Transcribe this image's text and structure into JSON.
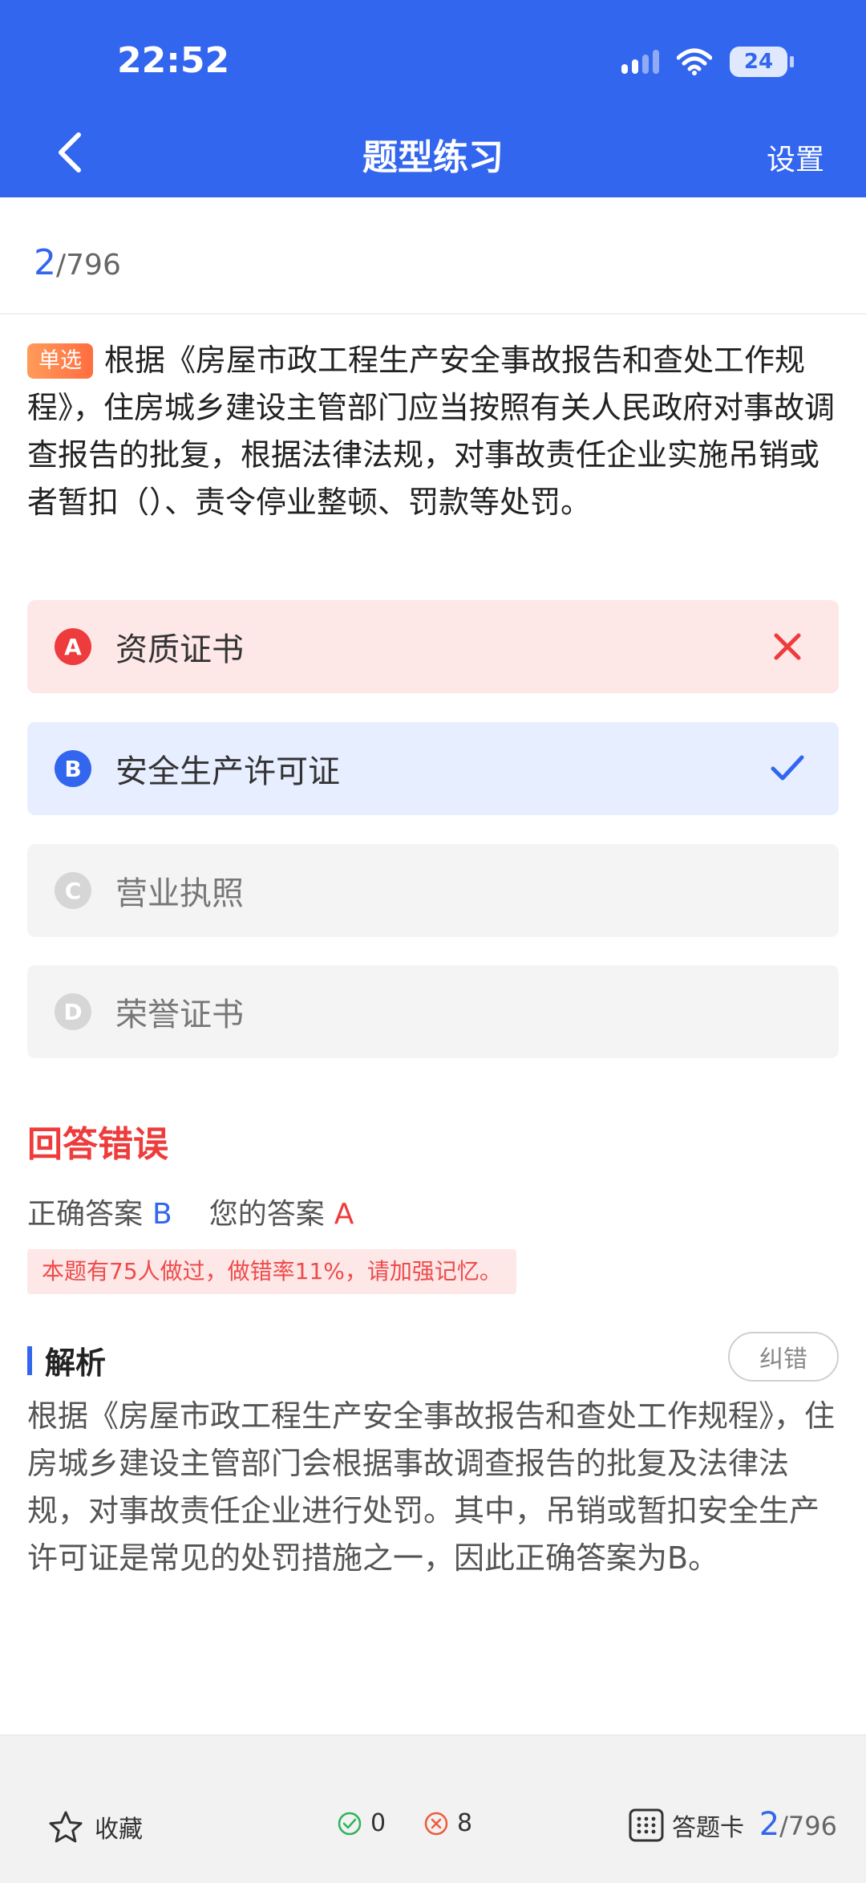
{
  "status_bar": {
    "time": "22:52",
    "battery": "24"
  },
  "header": {
    "title": "题型练习",
    "settings_label": "设置"
  },
  "progress": {
    "current": "2",
    "total": "/796"
  },
  "question": {
    "type": "单选",
    "text": "根据《房屋市政工程生产安全事故报告和查处工作规程》，住房城乡建设主管部门应当按照有关人民政府对事故调查报告的批复，根据法律法规，对事故责任企业实施吊销或者暂扣（）、责令停业整顿、罚款等处罚。"
  },
  "options": [
    {
      "letter": "A",
      "text": "资质证书",
      "state": "wrong"
    },
    {
      "letter": "B",
      "text": "安全生产许可证",
      "state": "correct"
    },
    {
      "letter": "C",
      "text": "营业执照",
      "state": "normal"
    },
    {
      "letter": "D",
      "text": "荣誉证书",
      "state": "normal"
    }
  ],
  "result": {
    "title": "回答错误",
    "correct_label": "正确答案",
    "correct_value": "B",
    "your_label": "您的答案",
    "your_value": "A",
    "tip": "本题有75人做过，做错率11%，请加强记忆。"
  },
  "analysis": {
    "label": "解析",
    "report_button": "纠错",
    "text": "根据《房屋市政工程生产安全事故报告和查处工作规程》，住房城乡建设主管部门会根据事故调查报告的批复及法律法规，对事故责任企业进行处罚。其中，吊销或暂扣安全生产许可证是常见的处罚措施之一，因此正确答案为B。"
  },
  "bottom_bar": {
    "favorite_label": "收藏",
    "correct_count": "0",
    "wrong_count": "8",
    "answer_card_label": "答题卡",
    "progress_current": "2",
    "progress_total": "/796"
  },
  "colors": {
    "primary": "#3366ee",
    "error": "#ee3b3b",
    "wrong_bg": "#fde7e7",
    "correct_bg": "#e7eeff"
  },
  "icons": [
    "back-chevron-icon",
    "signal-icon",
    "wifi-icon",
    "battery-icon",
    "cross-icon",
    "check-icon",
    "star-icon",
    "check-circle-icon",
    "cross-circle-icon",
    "grid-icon"
  ]
}
